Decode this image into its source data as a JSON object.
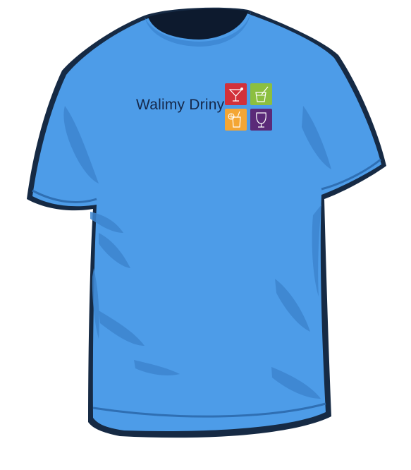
{
  "logo": {
    "text": "Walimy Driny",
    "tiles": [
      {
        "color": "#d2313a",
        "icon": "cocktail-glass-icon"
      },
      {
        "color": "#8cbf3f",
        "icon": "juice-glass-straw-icon"
      },
      {
        "color": "#f4a634",
        "icon": "orange-drink-icon"
      },
      {
        "color": "#5b2a78",
        "icon": "wine-glass-icon"
      }
    ]
  },
  "colors": {
    "shirt": "#4d9ce8",
    "shirt_shadow": "#3d85cf",
    "collar_inner": "#0d1a2e",
    "outline": "#162a44",
    "text": "#15284a"
  }
}
